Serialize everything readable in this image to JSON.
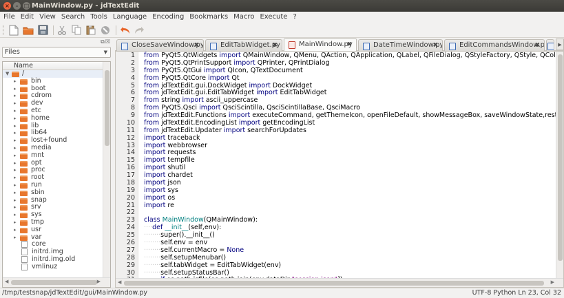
{
  "window": {
    "title": "MainWindow.py - jdTextEdit"
  },
  "menubar": [
    "File",
    "Edit",
    "View",
    "Search",
    "Tools",
    "Language",
    "Encoding",
    "Bookmarks",
    "Macro",
    "Execute",
    "?"
  ],
  "toolbar": {
    "icons": [
      "new-file-icon",
      "open-folder-icon",
      "save-icon",
      "cut-icon",
      "copy-icon",
      "paste-icon",
      "delete-icon",
      "undo-icon",
      "redo-icon"
    ]
  },
  "sidebar": {
    "combo_value": "Files",
    "column_header": "Name",
    "root_label": "/",
    "items": [
      {
        "label": "bin",
        "type": "folder"
      },
      {
        "label": "boot",
        "type": "folder"
      },
      {
        "label": "cdrom",
        "type": "folder"
      },
      {
        "label": "dev",
        "type": "folder"
      },
      {
        "label": "etc",
        "type": "folder"
      },
      {
        "label": "home",
        "type": "folder"
      },
      {
        "label": "lib",
        "type": "folder"
      },
      {
        "label": "lib64",
        "type": "folder"
      },
      {
        "label": "lost+found",
        "type": "folder"
      },
      {
        "label": "media",
        "type": "folder"
      },
      {
        "label": "mnt",
        "type": "folder"
      },
      {
        "label": "opt",
        "type": "folder"
      },
      {
        "label": "proc",
        "type": "folder"
      },
      {
        "label": "root",
        "type": "folder"
      },
      {
        "label": "run",
        "type": "folder"
      },
      {
        "label": "sbin",
        "type": "folder"
      },
      {
        "label": "snap",
        "type": "folder"
      },
      {
        "label": "srv",
        "type": "folder"
      },
      {
        "label": "sys",
        "type": "folder"
      },
      {
        "label": "tmp",
        "type": "folder"
      },
      {
        "label": "usr",
        "type": "folder"
      },
      {
        "label": "var",
        "type": "folder"
      },
      {
        "label": "core",
        "type": "file"
      },
      {
        "label": "initrd.img",
        "type": "file"
      },
      {
        "label": "initrd.img.old",
        "type": "file"
      },
      {
        "label": "vmlinuz",
        "type": "file"
      }
    ]
  },
  "tabs": [
    {
      "label": "CloseSaveWindow.py",
      "active": false
    },
    {
      "label": "EditTabWidget.py",
      "active": false
    },
    {
      "label": "MainWindow.py",
      "active": true
    },
    {
      "label": "DateTimeWindow.py",
      "active": false
    },
    {
      "label": "EditCommandsWindow.py",
      "active": false
    }
  ],
  "editor": {
    "lines": [
      [
        [
          "kw",
          "from "
        ],
        [
          "t",
          "PyQt5.QtWidgets "
        ],
        [
          "kw",
          "import "
        ],
        [
          "t",
          "QMainWindow, QMenu, QAction, QApplication, QLabel, QFileDialog, QStyleFactory, QStyle, QColorDialog, QInputDia"
        ]
      ],
      [
        [
          "kw",
          "from "
        ],
        [
          "t",
          "PyQt5.QtPrintSupport "
        ],
        [
          "kw",
          "import "
        ],
        [
          "t",
          "QPrinter, QPrintDialog"
        ]
      ],
      [
        [
          "kw",
          "from "
        ],
        [
          "t",
          "PyQt5.QtGui "
        ],
        [
          "kw",
          "import "
        ],
        [
          "t",
          "QIcon, QTextDocument"
        ]
      ],
      [
        [
          "kw",
          "from "
        ],
        [
          "t",
          "PyQt5.QtCore "
        ],
        [
          "kw",
          "import "
        ],
        [
          "t",
          "Qt"
        ]
      ],
      [
        [
          "kw",
          "from "
        ],
        [
          "t",
          "jdTextEdit.gui.DockWidget "
        ],
        [
          "kw",
          "import "
        ],
        [
          "t",
          "DockWidget"
        ]
      ],
      [
        [
          "kw",
          "from "
        ],
        [
          "t",
          "jdTextEdit.gui.EditTabWidget "
        ],
        [
          "kw",
          "import "
        ],
        [
          "t",
          "EditTabWidget"
        ]
      ],
      [
        [
          "kw",
          "from "
        ],
        [
          "t",
          "string "
        ],
        [
          "kw",
          "import "
        ],
        [
          "t",
          "ascii_uppercase"
        ]
      ],
      [
        [
          "kw",
          "from "
        ],
        [
          "t",
          "PyQt5.Qsci "
        ],
        [
          "kw",
          "import "
        ],
        [
          "t",
          "QsciScintilla, QsciScintillaBase, QsciMacro"
        ]
      ],
      [
        [
          "kw",
          "from "
        ],
        [
          "t",
          "jdTextEdit.Functions "
        ],
        [
          "kw",
          "import "
        ],
        [
          "t",
          "executeCommand, getThemeIcon, openFileDefault, showMessageBox, saveWindowState,restoreWindowState"
        ]
      ],
      [
        [
          "kw",
          "from "
        ],
        [
          "t",
          "jdTextEdit.EncodingList "
        ],
        [
          "kw",
          "import "
        ],
        [
          "t",
          "getEncodingList"
        ]
      ],
      [
        [
          "kw",
          "from "
        ],
        [
          "t",
          "jdTextEdit.Updater "
        ],
        [
          "kw",
          "import "
        ],
        [
          "t",
          "searchForUpdates"
        ]
      ],
      [
        [
          "kw",
          "import "
        ],
        [
          "t",
          "traceback"
        ]
      ],
      [
        [
          "kw",
          "import "
        ],
        [
          "t",
          "webbrowser"
        ]
      ],
      [
        [
          "kw",
          "import "
        ],
        [
          "t",
          "requests"
        ]
      ],
      [
        [
          "kw",
          "import "
        ],
        [
          "t",
          "tempfile"
        ]
      ],
      [
        [
          "kw",
          "import "
        ],
        [
          "t",
          "shutil"
        ]
      ],
      [
        [
          "kw",
          "import "
        ],
        [
          "t",
          "chardet"
        ]
      ],
      [
        [
          "kw",
          "import "
        ],
        [
          "t",
          "json"
        ]
      ],
      [
        [
          "kw",
          "import "
        ],
        [
          "t",
          "sys"
        ]
      ],
      [
        [
          "kw",
          "import "
        ],
        [
          "t",
          "os"
        ]
      ],
      [
        [
          "kw",
          "import "
        ],
        [
          "t",
          "re"
        ]
      ],
      [],
      [
        [
          "kw",
          "class "
        ],
        [
          "fn",
          "MainWindow"
        ],
        [
          "t",
          "(QMainWindow):"
        ]
      ],
      [
        [
          "ind",
          "····"
        ],
        [
          "kw",
          "def "
        ],
        [
          "fn",
          "__init__"
        ],
        [
          "t",
          "(self,env):"
        ]
      ],
      [
        [
          "ind",
          "········"
        ],
        [
          "t",
          "super().__init__()"
        ]
      ],
      [
        [
          "ind",
          "········"
        ],
        [
          "t",
          "self.env = env"
        ]
      ],
      [
        [
          "ind",
          "········"
        ],
        [
          "t",
          "self.currentMacro = "
        ],
        [
          "kw",
          "None"
        ]
      ],
      [
        [
          "ind",
          "········"
        ],
        [
          "t",
          "self.setupMenubar()"
        ]
      ],
      [
        [
          "ind",
          "········"
        ],
        [
          "t",
          "self.tabWidget = EditTabWidget(env)"
        ]
      ],
      [
        [
          "ind",
          "········"
        ],
        [
          "t",
          "self.setupStatusBar()"
        ]
      ],
      [
        [
          "ind",
          "········"
        ],
        [
          "kw",
          "if "
        ],
        [
          "t",
          "os.path.isfile(os.path.join(env.dataDir,"
        ],
        [
          "str",
          "\"session.json\""
        ],
        [
          "t",
          "]):"
        ]
      ]
    ]
  },
  "statusbar": {
    "path": "/tmp/testsnap/jdTextEdit/gui/MainWindow.py",
    "info": "UTF-8  Python  Ln 23, Col 32"
  }
}
